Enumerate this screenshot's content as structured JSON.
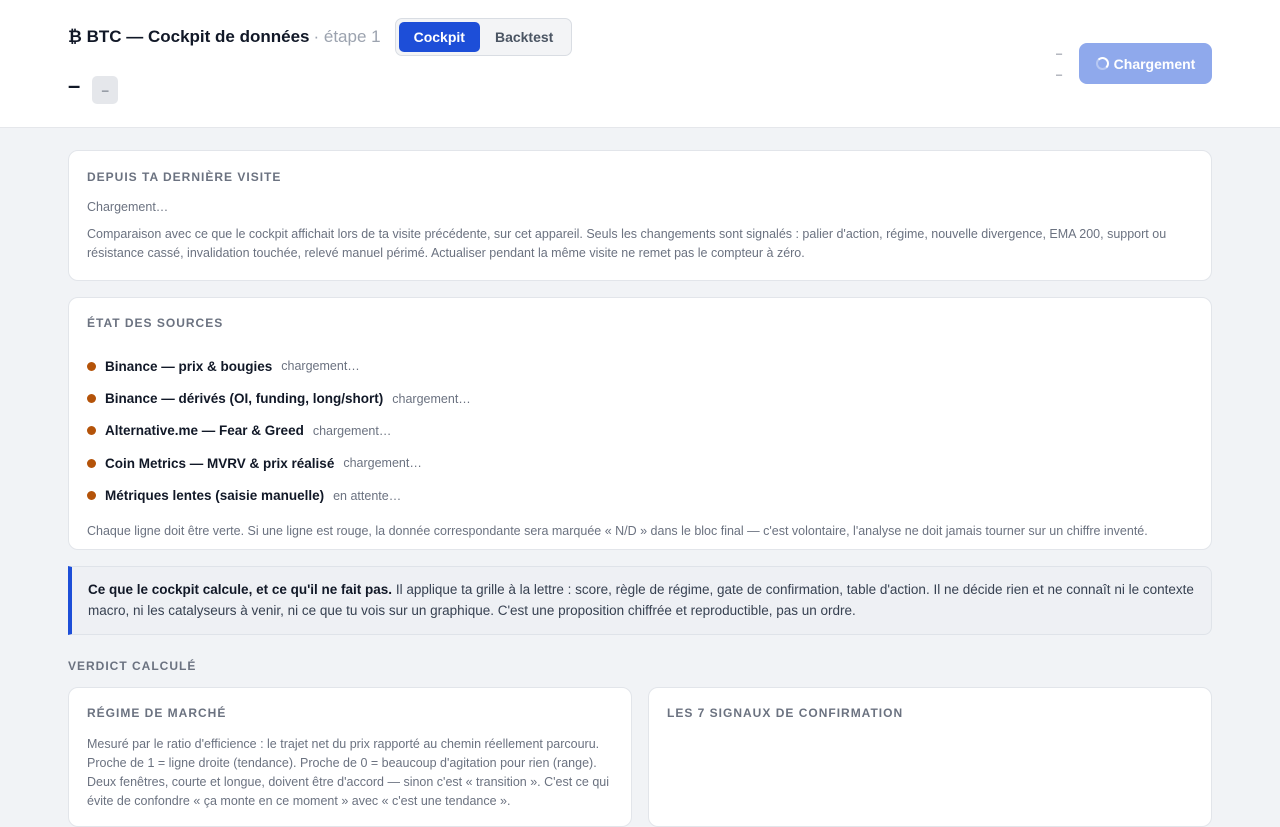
{
  "header": {
    "title": "₿ BTC — Cockpit de données",
    "subtitle": "· étape 1",
    "tabs": [
      {
        "label": "Cockpit",
        "active": true
      },
      {
        "label": "Backtest",
        "active": false
      }
    ],
    "price": "–",
    "price_change": "–",
    "meta_line_1": "–",
    "meta_line_2": "–",
    "load_button_label": "Chargement"
  },
  "since_last_visit": {
    "heading": "Depuis ta dernière visite",
    "status": "Chargement…",
    "description": "Comparaison avec ce que le cockpit affichait lors de ta visite précédente, sur cet appareil. Seuls les changements sont signalés : palier d'action, régime, nouvelle divergence, EMA 200, support ou résistance cassé, invalidation touchée, relevé manuel périmé. Actualiser pendant la même visite ne remet pas le compteur à zéro."
  },
  "sources": {
    "heading": "État des sources",
    "items": [
      {
        "name": "Binance — prix & bougies",
        "status": "chargement…"
      },
      {
        "name": "Binance — dérivés (OI, funding, long/short)",
        "status": "chargement…"
      },
      {
        "name": "Alternative.me — Fear & Greed",
        "status": "chargement…"
      },
      {
        "name": "Coin Metrics — MVRV & prix réalisé",
        "status": "chargement…"
      },
      {
        "name": "Métriques lentes (saisie manuelle)",
        "status": "en attente…"
      }
    ],
    "status_color": "#b45309",
    "footnote": "Chaque ligne doit être verte. Si une ligne est rouge, la donnée correspondante sera marquée « N/D » dans le bloc final — c'est volontaire, l'analyse ne doit jamais tourner sur un chiffre inventé."
  },
  "callout": {
    "lead": "Ce que le cockpit calcule, et ce qu'il ne fait pas.",
    "text": " Il applique ta grille à la lettre : score, règle de régime, gate de confirmation, table d'action. Il ne décide rien et ne connaît ni le contexte macro, ni les catalyseurs à venir, ni ce que tu vois sur un graphique. C'est une proposition chiffrée et reproductible, pas un ordre."
  },
  "verdict": {
    "heading": "VERDICT CALCULÉ",
    "regime": {
      "heading": "Régime de marché",
      "description": "Mesuré par le ratio d'efficience : le trajet net du prix rapporté au chemin réellement parcouru. Proche de 1 = ligne droite (tendance). Proche de 0 = beaucoup d'agitation pour rien (range). Deux fenêtres, courte et longue, doivent être d'accord — sinon c'est « transition ». C'est ce qui évite de confondre « ça monte en ce moment » avec « c'est une tendance »."
    },
    "signals": {
      "heading": "Les 7 signaux de confirmation"
    }
  },
  "colors": {
    "accent": "#1d4ed8",
    "button_loading": "#8fa9ec",
    "pending_dot": "#b45309"
  }
}
